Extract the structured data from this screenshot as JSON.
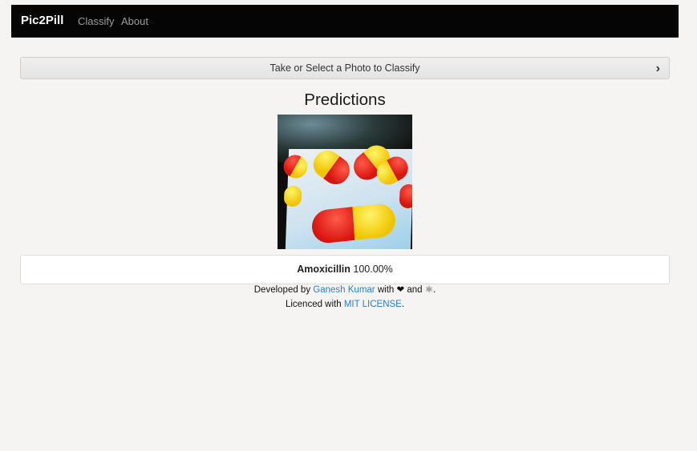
{
  "navbar": {
    "brand": "Pic2Pill",
    "links": [
      "Classify",
      "About"
    ]
  },
  "classify_button": {
    "label": "Take or Select a Photo to Classify",
    "icon": "chevron-right-icon"
  },
  "predictions": {
    "title": "Predictions",
    "image_description": "photo of red and yellow capsules on a screen",
    "result": {
      "name": "Amoxicillin",
      "confidence": "100.00%"
    }
  },
  "footer": {
    "developed_prefix": "Developed by",
    "author": "Ganesh Kumar",
    "with": "with",
    "heart": "❤",
    "and": "and",
    "react_symbol": "⚛",
    "period": ".",
    "licence_prefix": "Licenced with",
    "license": "MIT LICENSE",
    "license_period": "."
  },
  "colors": {
    "navbar_bg": "#050505",
    "link": "#2a7fd1",
    "page_bg": "#f5f4f2"
  }
}
